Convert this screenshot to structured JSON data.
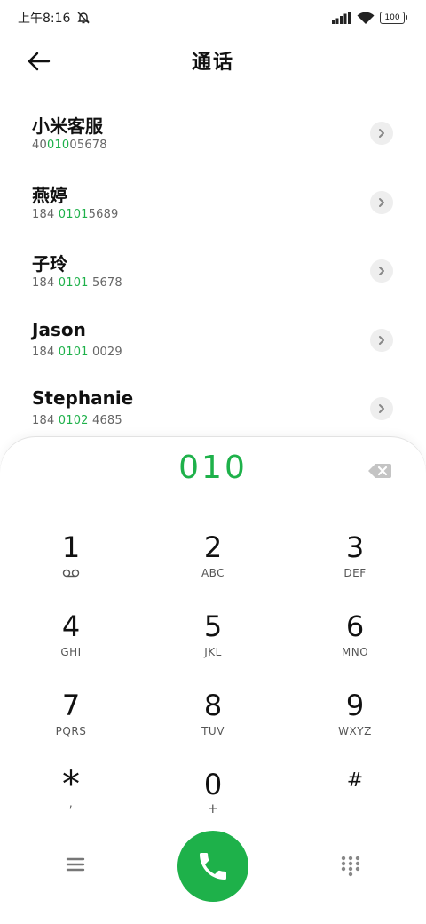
{
  "status_bar": {
    "time": "上午8:16",
    "battery": "100",
    "icons": [
      "dnd-off-icon",
      "signal-icon",
      "wifi-icon",
      "battery-icon"
    ]
  },
  "header": {
    "title": "通话",
    "back_icon": "arrow-left-icon"
  },
  "contacts": [
    {
      "name": "小米客服",
      "number_parts": [
        "40",
        "010",
        "05678"
      ]
    },
    {
      "name": "燕婷",
      "number_parts": [
        "184 ",
        "0101",
        "5689"
      ]
    },
    {
      "name": "子玲",
      "number_parts": [
        "184 ",
        "0101",
        " 5678"
      ]
    },
    {
      "name": "Jason",
      "number_parts": [
        "184 ",
        "0101",
        " 0029"
      ]
    },
    {
      "name": "Stephanie",
      "number_parts": [
        "184 ",
        "0102",
        " 4685"
      ]
    }
  ],
  "dialpad": {
    "input": "010",
    "keys": [
      {
        "digit": "1",
        "letters": ""
      },
      {
        "digit": "2",
        "letters": "ABC"
      },
      {
        "digit": "3",
        "letters": "DEF"
      },
      {
        "digit": "4",
        "letters": "GHI"
      },
      {
        "digit": "5",
        "letters": "JKL"
      },
      {
        "digit": "6",
        "letters": "MNO"
      },
      {
        "digit": "7",
        "letters": "PQRS"
      },
      {
        "digit": "8",
        "letters": "TUV"
      },
      {
        "digit": "9",
        "letters": "WXYZ"
      },
      {
        "digit": "*",
        "letters": ","
      },
      {
        "digit": "0",
        "letters": "+"
      },
      {
        "digit": "#",
        "letters": ""
      }
    ]
  },
  "bottom_bar": {
    "icons": [
      "menu-icon",
      "phone-icon",
      "dialpad-icon"
    ]
  },
  "colors": {
    "accent": "#1eb14a",
    "detail_bg": "#eeeeee"
  }
}
